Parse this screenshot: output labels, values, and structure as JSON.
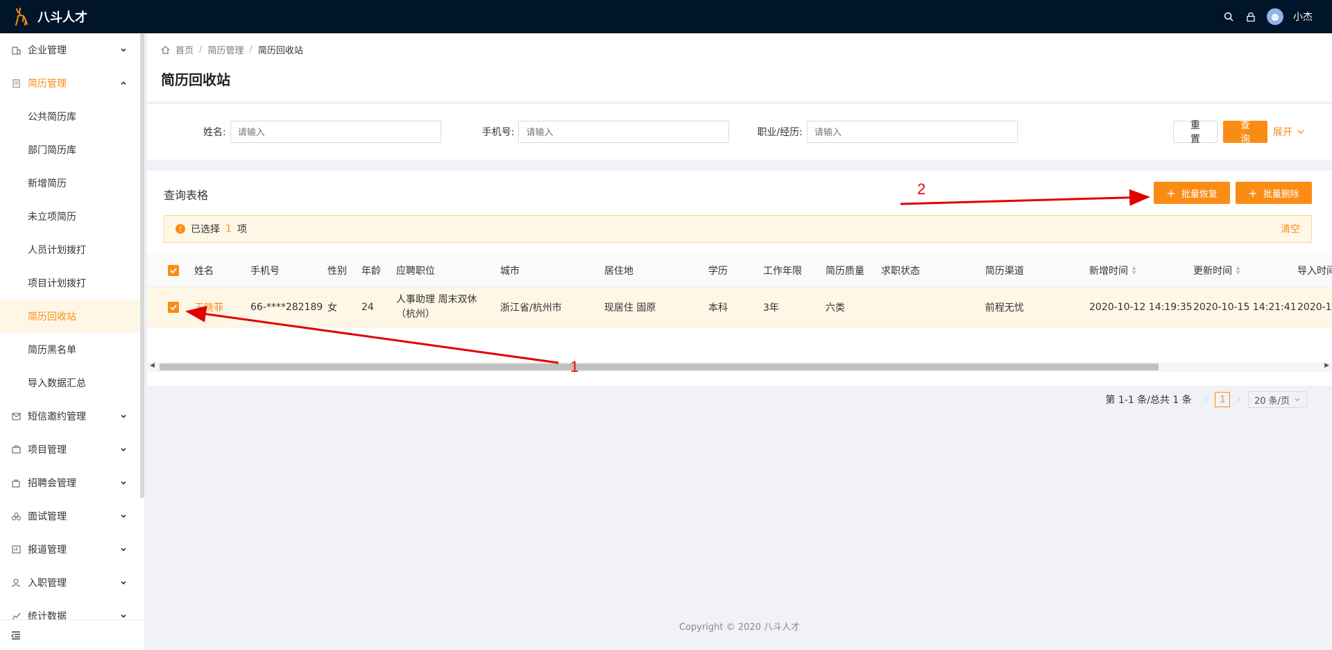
{
  "app": {
    "name": "八斗人才",
    "username": "小杰"
  },
  "sidebar": {
    "items": [
      {
        "label": "企业管理",
        "icon": "building-icon"
      },
      {
        "label": "简历管理",
        "icon": "document-icon",
        "open": true,
        "children": [
          "公共简历库",
          "部门简历库",
          "新增简历",
          "未立项简历",
          "人员计划拨打",
          "项目计划拨打",
          "简历回收站",
          "简历黑名单",
          "导入数据汇总"
        ],
        "active_child": "简历回收站"
      },
      {
        "label": "短信邀约管理",
        "icon": "mail-icon"
      },
      {
        "label": "项目管理",
        "icon": "project-icon"
      },
      {
        "label": "招聘会管理",
        "icon": "bag-icon"
      },
      {
        "label": "面试管理",
        "icon": "people-icon"
      },
      {
        "label": "报道管理",
        "icon": "report-icon"
      },
      {
        "label": "入职管理",
        "icon": "user-icon"
      },
      {
        "label": "统计数据",
        "icon": "chart-icon"
      }
    ]
  },
  "breadcrumb": {
    "home": "首页",
    "parent": "简历管理",
    "current": "简历回收站",
    "separator": "/"
  },
  "page": {
    "title": "简历回收站"
  },
  "filters": {
    "name_label": "姓名:",
    "name_placeholder": "请输入",
    "phone_label": "手机号:",
    "phone_placeholder": "请输入",
    "job_label": "职业/经历:",
    "job_placeholder": "请输入",
    "reset": "重 置",
    "search": "查 询",
    "expand": "展开"
  },
  "table": {
    "title": "查询表格",
    "batch_restore": "批量恢复",
    "batch_delete": "批量删除",
    "selection": {
      "prefix": "已选择",
      "count": "1",
      "suffix": "项",
      "clear": "清空"
    },
    "columns": [
      "姓名",
      "手机号",
      "性别",
      "年龄",
      "应聘职位",
      "城市",
      "居住地",
      "学历",
      "工作年限",
      "简历质量",
      "求职状态",
      "简历渠道",
      "新增时间",
      "更新时间",
      "导入时间"
    ],
    "rows": [
      {
        "name": "王晓菲",
        "phone": "66-****282189",
        "gender": "女",
        "age": "24",
        "position": "人事助理 周末双休（杭州）",
        "city": "浙江省/杭州市",
        "residence": "现居住 固原",
        "education": "本科",
        "years": "3年",
        "quality": "六类",
        "status": "",
        "channel": "前程无忧",
        "created": "2020-10-12 14:19:35",
        "updated": "2020-10-15 14:21:41",
        "imported": "2020-1"
      }
    ]
  },
  "pagination": {
    "summary": "第 1-1 条/总共 1 条",
    "current_page": "1",
    "page_size": "20 条/页"
  },
  "footer": {
    "copyright": "Copyright © 2020 八斗人才"
  },
  "annotations": {
    "label_1": "1",
    "label_2": "2",
    "color": "#e00000"
  },
  "colors": {
    "topbar": "#001529",
    "accent": "#fa8c16"
  }
}
